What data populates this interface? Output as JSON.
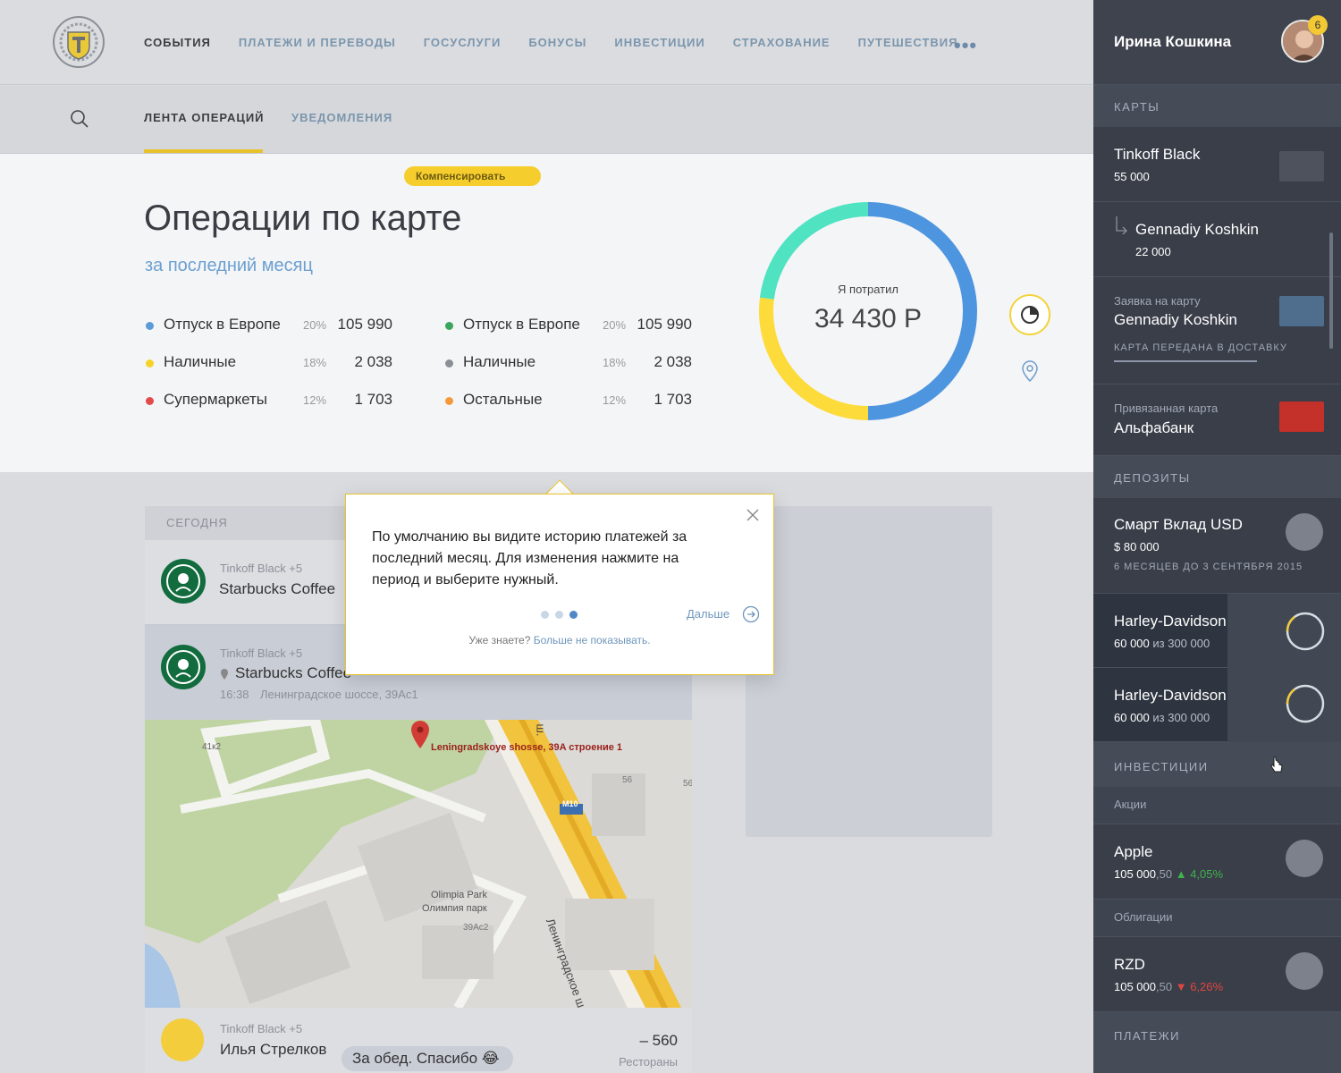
{
  "nav": {
    "items": [
      "СОБЫТИЯ",
      "ПЛАТЕЖИ И ПЕРЕВОДЫ",
      "ГОСУСЛУГИ",
      "БОНУСЫ",
      "ИНВЕСТИЦИИ",
      "СТРАХОВАНИЕ",
      "ПУТЕШЕСТВИЯ"
    ],
    "more": "•••"
  },
  "subnav": {
    "tab1": "ЛЕНТА ОПЕРАЦИЙ",
    "tab2": "УВЕДОМЛЕНИЯ"
  },
  "summary": {
    "title": "Операции по карте",
    "period": "за последний месяц",
    "donut_label": "Я потратил",
    "donut_value": "34 430 Р"
  },
  "legend": [
    {
      "name": "Отпуск в Европе",
      "pct": "20%",
      "value": "105 990",
      "color": "#5a9bd8"
    },
    {
      "name": "Наличные",
      "pct": "18%",
      "value": "2 038",
      "color": "#f5d327"
    },
    {
      "name": "Супермаркеты",
      "pct": "12%",
      "value": "1 703",
      "color": "#e24b4b"
    },
    {
      "name": "Отпуск в Европе",
      "pct": "20%",
      "value": "105 990",
      "color": "#3aa55d"
    },
    {
      "name": "Наличные",
      "pct": "18%",
      "value": "2 038",
      "color": "#8b9096"
    },
    {
      "name": "Остальные",
      "pct": "12%",
      "value": "1 703",
      "color": "#f59a3a"
    }
  ],
  "chart_data": {
    "type": "pie",
    "title": "Я потратил",
    "categories": [
      "Синий",
      "Жёлтый",
      "Бирюзовый"
    ],
    "values": [
      50,
      27,
      23
    ],
    "colors": [
      "#4e95e0",
      "#fddb3a",
      "#4fe3c1"
    ]
  },
  "feed": {
    "header": "СЕГОДНЯ",
    "row1": {
      "meta": "Tinkoff Black +5",
      "name": "Starbucks Coffee"
    },
    "row2": {
      "meta": "Tinkoff Black +5",
      "name": "Starbucks Coffee",
      "time": "16:38",
      "address": "Ленинградское шоссе, 39Ас1",
      "compensate": "Компенсировать"
    },
    "map": {
      "pin": "Leningradskoye shosse, 39A строение 1",
      "road": "Ленинградское ш.",
      "park1": "Olimpia Park",
      "park2": "Олимпия парк",
      "l1": "41к2",
      "l2": "56",
      "l3": "56",
      "l4": "M10",
      "l5": "39Ас2",
      "l6": "ш."
    },
    "row3": {
      "meta": "Tinkoff Black +5",
      "name": "Илья Стрелков",
      "message": "За обед. Спасибо 😂",
      "amount": "– 560",
      "category": "Рестораны"
    }
  },
  "tooltip": {
    "text": "По умолчанию вы видите историю платежей за последний месяц. Для изменения нажмите на период и выберите нужный.",
    "next": "Дальше",
    "foot_q": "Уже знаете?",
    "foot_link": "Больше не показывать."
  },
  "sidebar": {
    "user": "Ирина Кошкина",
    "badge": "6",
    "sections": {
      "cards": "КАРТЫ",
      "deposits": "ДЕПОЗИТЫ",
      "investments": "ИНВЕСТИЦИИ",
      "payments": "ПЛАТЕЖИ"
    },
    "cards": [
      {
        "name": "Tinkoff Black",
        "sub": "55 000"
      },
      {
        "name": "Gennadiy Koshkin",
        "sub": "22 000"
      },
      {
        "label": "Заявка на карту",
        "name": "Gennadiy Koshkin",
        "status": "КАРТА ПЕРЕДАНА В ДОСТАВКУ"
      },
      {
        "label": "Привязанная карта",
        "name": "Альфабанк"
      }
    ],
    "deposits": [
      {
        "name": "Смарт Вклад USD",
        "sub": "$ 80 000",
        "note": "6 МЕСЯЦЕВ ДО 3 СЕНТЯБРЯ 2015"
      },
      {
        "name": "Harley-Davidson",
        "sub": "60 000",
        "of": "из 300 000"
      },
      {
        "name": "Harley-Davidson",
        "sub": "60 000",
        "of": "из 300 000"
      }
    ],
    "invest": {
      "stocks": "Акции",
      "bonds": "Облигации",
      "apple": {
        "name": "Apple",
        "val": "105 000",
        "dec": ",50",
        "chg": "4,05%"
      },
      "rzd": {
        "name": "RZD",
        "val": "105 000",
        "dec": ",50",
        "chg": "6,26%"
      }
    }
  }
}
